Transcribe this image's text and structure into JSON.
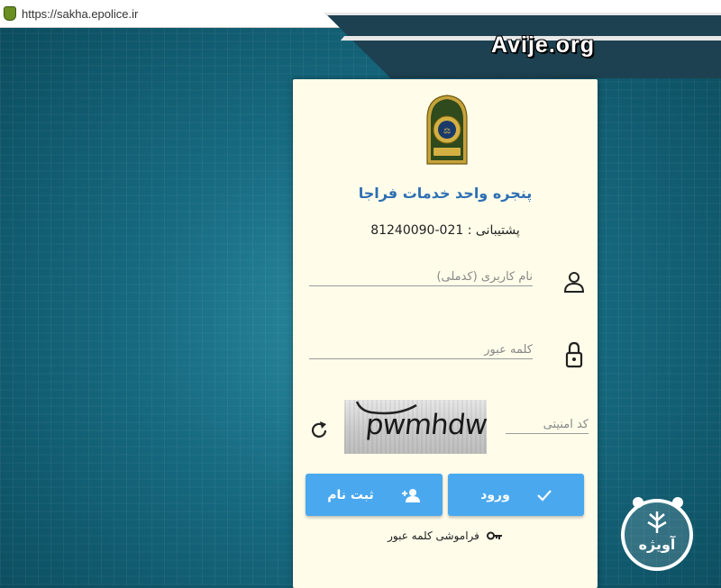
{
  "browser": {
    "url": "https://sakha.epolice.ir"
  },
  "banner": {
    "text": "Avije.org"
  },
  "card": {
    "title": "پنجره واحد خدمات فراجا",
    "support": "پشتیبانی : 021-81240090"
  },
  "form": {
    "username_placeholder": "نام کاربری (کدملی)",
    "password_placeholder": "کلمه عبور",
    "captcha_placeholder": "کد امنیتی",
    "captcha_text": "pwmhdw"
  },
  "buttons": {
    "login_label": "ورود",
    "register_label": "ثبت نام"
  },
  "links": {
    "forgot_password": "فراموشی کلمه عبور"
  },
  "watermark": {
    "text": "آویژه"
  },
  "colors": {
    "title_blue": "#2d6fb3",
    "button_blue": "#4aa8ef",
    "card_bg": "#fffdea",
    "page_bg": "#16697f"
  },
  "icons": [
    "person-icon",
    "lock-icon",
    "refresh-icon",
    "checkmark-icon",
    "person-add-icon",
    "key-icon"
  ]
}
